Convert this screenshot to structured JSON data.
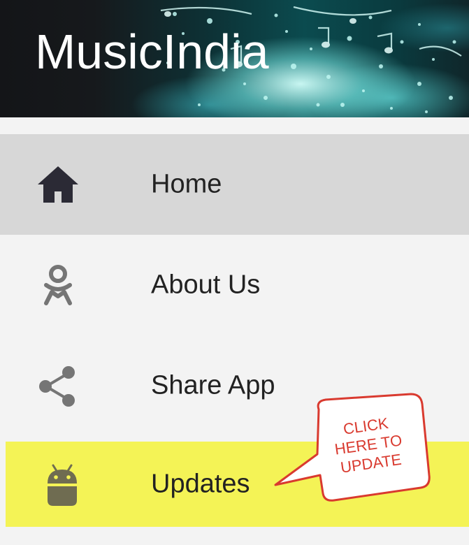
{
  "header": {
    "app_title": "MusicIndia"
  },
  "menu": {
    "items": [
      {
        "label": "Home",
        "icon": "home-icon",
        "selected": true
      },
      {
        "label": "About Us",
        "icon": "person-icon"
      },
      {
        "label": "Share App",
        "icon": "share-icon"
      },
      {
        "label": "Updates",
        "icon": "android-icon",
        "highlighted": true
      }
    ]
  },
  "callout": {
    "text": "CLICK\nHERE TO\nUPDATE"
  },
  "colors": {
    "selected_bg": "#d7d7d7",
    "highlight_bg": "#f4f356",
    "callout_border": "#d93a2f",
    "icon_dark": "#2b2a35",
    "icon_grey": "#757575",
    "android_icon": "#6f6c51"
  }
}
